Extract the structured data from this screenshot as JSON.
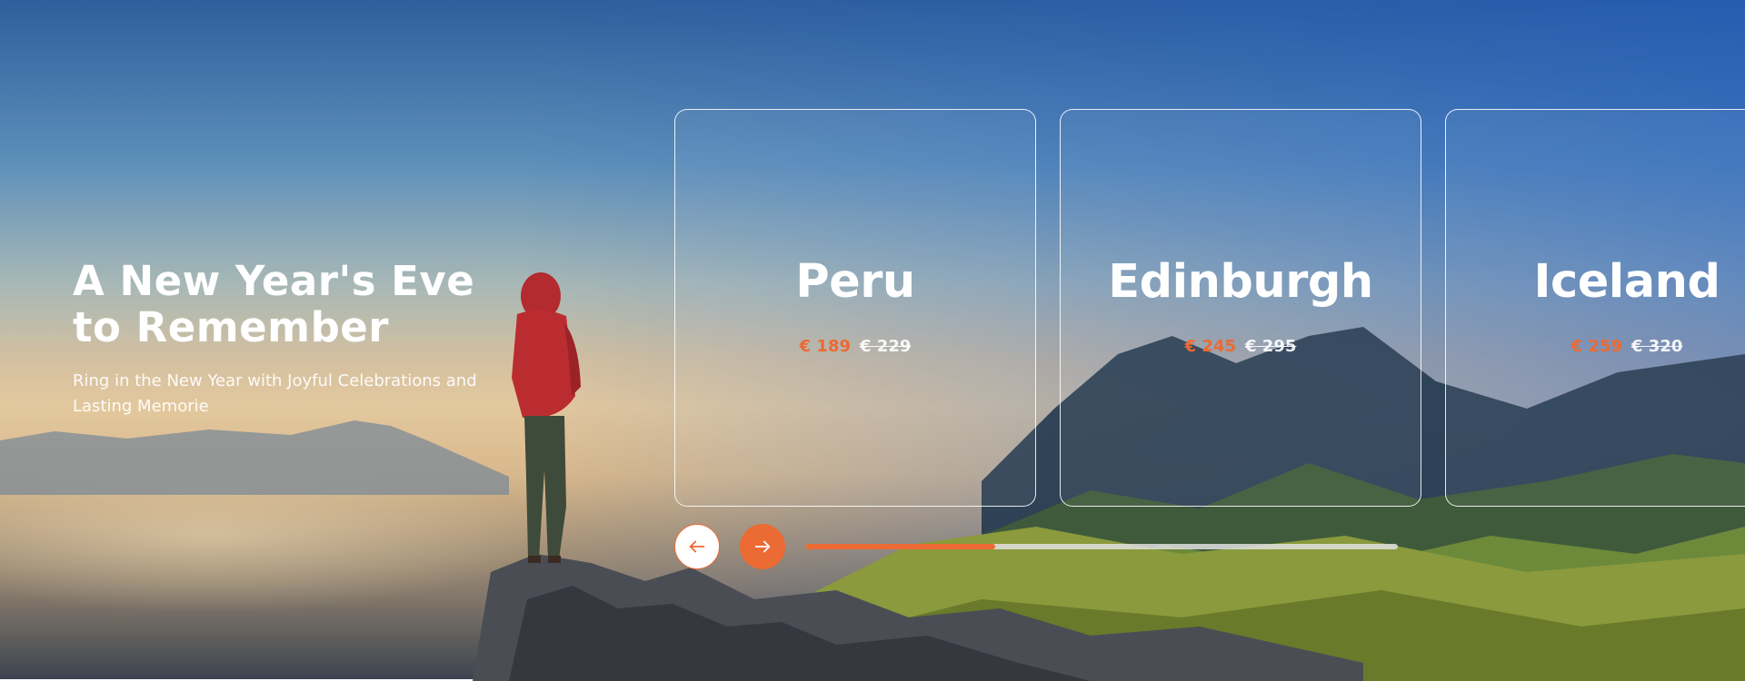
{
  "hero": {
    "title": "A New Year's Eve to Remember",
    "subtitle": "Ring in the New Year with Joyful Celebrations and Lasting Memorie"
  },
  "destinations": [
    {
      "name": "Peru",
      "price": "€ 189",
      "old_price": "€ 229"
    },
    {
      "name": "Edinburgh",
      "price": "€ 245",
      "old_price": "€ 295"
    },
    {
      "name": "Iceland",
      "price": "€ 259",
      "old_price": "€ 320"
    }
  ],
  "slider": {
    "prev_icon": "arrow-left-icon",
    "next_icon": "arrow-right-icon",
    "progress": 0.32
  },
  "colors": {
    "accent": "#ec6a33",
    "text": "#ffffff"
  }
}
